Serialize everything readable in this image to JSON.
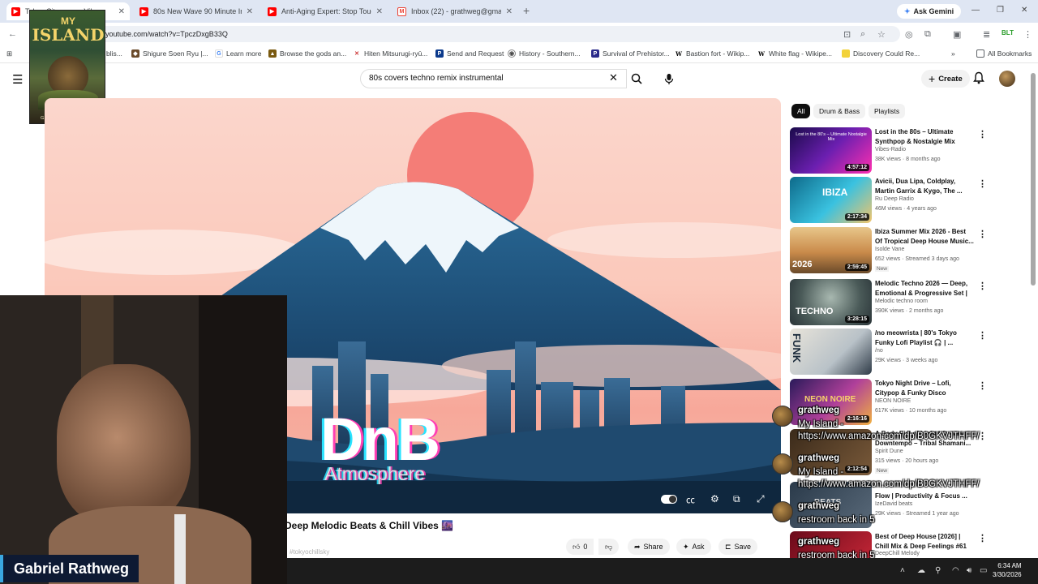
{
  "browser": {
    "tabs": [
      {
        "title": "Tokyo Cityscapes Vibes",
        "active": true,
        "favicon": "youtube-icon",
        "color": "#ff0000"
      },
      {
        "title": "80s New Wave 90 Minute Instru",
        "active": false,
        "favicon": "youtube-icon",
        "color": "#ff0000"
      },
      {
        "title": "Anti-Aging Expert: Stop Touchi",
        "active": false,
        "favicon": "youtube-icon",
        "color": "#ff0000"
      },
      {
        "title": "Inbox (22) - grathweg@gmail.c",
        "active": false,
        "favicon": "gmail-icon",
        "color": "#ea4335"
      }
    ],
    "ask_gemini": "Ask Gemini",
    "url": "youtube.com/watch?v=TpczDxgB33Q",
    "bookmarks": [
      {
        "label": "Shigure Soen Ryu |...",
        "icon": "page-icon"
      },
      {
        "label": "Learn more",
        "icon": "google-icon"
      },
      {
        "label": "Browse the gods an...",
        "icon": "page-icon"
      },
      {
        "label": "Hiten Mitsurugi-ryū...",
        "icon": "page-icon"
      },
      {
        "label": "Send and Request",
        "icon": "paypal-icon"
      },
      {
        "label": "History - Southern...",
        "icon": "page-icon"
      },
      {
        "label": "Survival of Prehistor...",
        "icon": "page-icon"
      },
      {
        "label": "Bastion fort - Wikip...",
        "icon": "wikipedia-icon"
      },
      {
        "label": "White flag - Wikipe...",
        "icon": "wikipedia-icon"
      },
      {
        "label": "Discovery Could Re...",
        "icon": "page-icon"
      }
    ],
    "bookmark_partial": "blis...",
    "all_bookmarks": "All Bookmarks"
  },
  "book_overlay": {
    "title_top": "MY",
    "title_main": "ISLAND",
    "author": "GABRIEL L. RATHWEG"
  },
  "youtube": {
    "search_query": "80s covers techno remix instrumental",
    "create_label": "Create",
    "video": {
      "overlay_title": "DnB",
      "overlay_subtitle": "Atmosphere",
      "title": "Deep Melodic Beats & Chill Vibes 🌆",
      "channel_partial": "#tokyochillsky",
      "likes": "0",
      "share": "Share",
      "ask": "Ask",
      "save": "Save"
    },
    "chips": [
      {
        "label": "All",
        "selected": true
      },
      {
        "label": "Drum & Bass",
        "selected": false
      },
      {
        "label": "Playlists",
        "selected": false
      }
    ],
    "recommendations": [
      {
        "title": "Lost in the 80s – Ultimate Synthpop & Nostalgie Mix",
        "channel": "Vibes-Radio",
        "meta": "38K views · 8 months ago",
        "duration": "4:57:12",
        "thumb_text": "Lost in the 80's – Ultimate Nostalgie Mix"
      },
      {
        "title": "Avicii, Dua Lipa, Coldplay, Martin Garrix & Kygo, The ...",
        "channel": "Ru Deep Radio",
        "meta": "46M views · 4 years ago",
        "duration": "2:17:34",
        "thumb_text": "IBIZA"
      },
      {
        "title": "Ibiza Summer Mix 2026 - Best Of Tropical Deep House Music...",
        "channel": "Isolde Vane",
        "meta": "652 views · Streamed 3 days ago",
        "badge": "New",
        "duration": "2:59:45",
        "thumb_text": "2026"
      },
      {
        "title": "Melodic Techno 2026 — Deep, Emotional & Progressive Set | ...",
        "channel": "Melodic techno room",
        "meta": "390K views · 2 months ago",
        "duration": "3:28:15",
        "thumb_text": "TECHNO"
      },
      {
        "title": "/no meowrista | 80's Tokyo Funky Lofi Playlist 🎧 | ...",
        "channel": "/no",
        "meta": "29K views · 3 weeks ago",
        "duration": "",
        "thumb_text": "FUNK"
      },
      {
        "title": "Tokyo Night Drive – Lofi, Citypop & Funky Disco Groove...",
        "channel": "NEON NOIRE",
        "meta": "617K views · 10 months ago",
        "duration": "2:16:16",
        "thumb_text": "NEON NOIRE"
      },
      {
        "title": "A Body Full of Light | Organic Downtempo – Tribal Shamani...",
        "channel": "Spirit Dune",
        "meta": "315 views · 20 hours ago",
        "badge": "New",
        "duration": "2:12:54",
        "thumb_text": ""
      },
      {
        "title": "Flow | Productivity & Focus ...",
        "channel": "IzeDavid beats",
        "meta": "29K views · Streamed 1 year ago",
        "duration": "",
        "thumb_text": "BEATS"
      },
      {
        "title": "Best of Deep House [2026] | Chill Mix & Deep Feelings #61",
        "channel": "DeepChill Melody",
        "meta": "",
        "duration": "",
        "thumb_text": ""
      }
    ]
  },
  "chat": [
    {
      "user": "grathweg",
      "line1": "My Island -",
      "line2": "https://www.amazon.com/dp/B0GKVJTHFF/"
    },
    {
      "user": "grathweg",
      "line1": "My Island -",
      "line2": "https://www.amazon.com/dp/B0GKVJTHFF/"
    },
    {
      "user": "grathweg",
      "line1": "restroom back in 5",
      "line2": ""
    },
    {
      "user": "grathweg",
      "line1": "restroom back in 5",
      "line2": ""
    }
  ],
  "webcam": {
    "name": "Gabriel Rathweg"
  },
  "taskbar": {
    "time": "6:34 AM",
    "date": "3/30/2026"
  }
}
